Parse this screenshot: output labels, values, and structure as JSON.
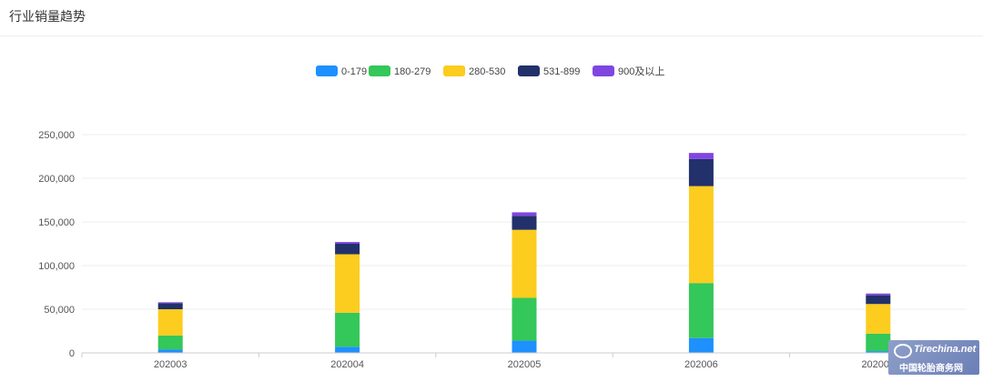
{
  "header": {
    "title": "行业销量趋势"
  },
  "colors": {
    "0-179": "#1e90ff",
    "180-279": "#34c759",
    "280-530": "#fccc1f",
    "531-899": "#22306b",
    "900及以上": "#8046e0"
  },
  "chart_data": {
    "type": "bar",
    "stacked": true,
    "categories": [
      "202003",
      "202004",
      "202005",
      "202006",
      "202007"
    ],
    "series": [
      {
        "name": "0-179",
        "values": [
          4000,
          7000,
          14000,
          17000,
          2000
        ]
      },
      {
        "name": "180-279",
        "values": [
          16000,
          39000,
          49000,
          63000,
          20000
        ]
      },
      {
        "name": "280-530",
        "values": [
          30000,
          67000,
          78000,
          111000,
          34000
        ]
      },
      {
        "name": "531-899",
        "values": [
          7000,
          12000,
          16000,
          31000,
          10000
        ]
      },
      {
        "name": "900及以上",
        "values": [
          1000,
          2000,
          4000,
          7000,
          2000
        ]
      }
    ],
    "yticks": [
      "0",
      "50,000",
      "100,000",
      "150,000",
      "200,000",
      "250,000"
    ],
    "ylim": [
      0,
      250000
    ],
    "legend_position": "top-center",
    "grid": true
  },
  "watermark": {
    "brand": "Tirechina.net",
    "text": "中国轮胎商务网"
  }
}
